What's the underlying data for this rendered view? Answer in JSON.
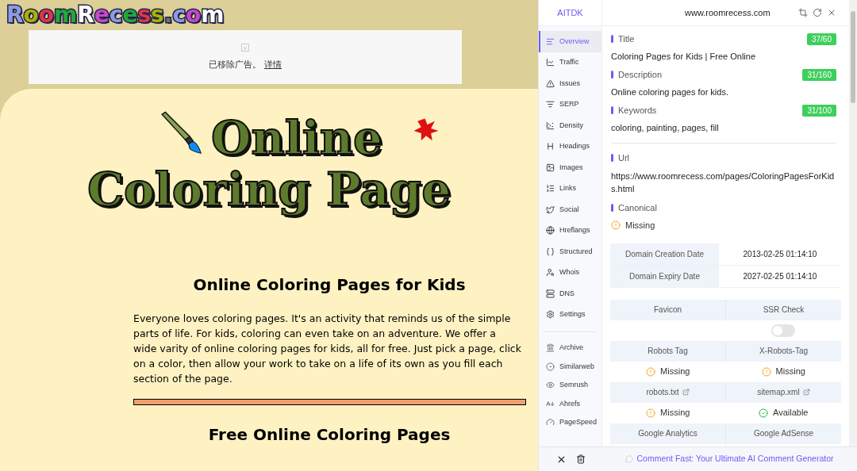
{
  "site": {
    "logo_letters": [
      {
        "char": "R",
        "color": "#8c9ce0"
      },
      {
        "char": "o",
        "color": "#a8b400"
      },
      {
        "char": "o",
        "color": "#e2334a"
      },
      {
        "char": "m",
        "color": "#22a83a"
      },
      {
        "char": "R",
        "color": "#ffffff"
      },
      {
        "char": "e",
        "color": "#c848c8"
      },
      {
        "char": "c",
        "color": "#8c9ce0"
      },
      {
        "char": "e",
        "color": "#22a83a"
      },
      {
        "char": "s",
        "color": "#e2334a"
      },
      {
        "char": "s",
        "color": "#a8b400"
      },
      {
        "char": ".",
        "color": "#707070"
      },
      {
        "char": "c",
        "color": "#8c9ce0"
      },
      {
        "char": "o",
        "color": "#c848c8"
      },
      {
        "char": "m",
        "color": "#ffffff"
      }
    ],
    "ad_notice": {
      "text": "已移除广告。",
      "link": "详情"
    },
    "banner": {
      "line_1": "Online",
      "line_2": "Coloring Page"
    },
    "heading": "Online Coloring Pages for Kids",
    "intro": "Everyone loves coloring pages. It's an activity that reminds us of the simple parts of life. For kids, coloring can even take on an adventure. We offer a wide varity of online coloring pages for kids, all for free. Just pick a page, click on a color, then allow your work to take on a life of its own as you fill each section of the page.",
    "subheading": "Free Online Coloring Pages"
  },
  "extension": {
    "brand": "AITDK",
    "domain": "www.roomrecess.com",
    "nav": [
      {
        "label": "Overview",
        "selected": true
      },
      {
        "label": "Traffic",
        "selected": false
      },
      {
        "label": "Issues",
        "selected": false
      },
      {
        "label": "SERP",
        "selected": false
      },
      {
        "label": "Density",
        "selected": false
      },
      {
        "label": "Headings",
        "selected": false
      },
      {
        "label": "Images",
        "selected": false
      },
      {
        "label": "Links",
        "selected": false
      },
      {
        "label": "Social",
        "selected": false
      },
      {
        "label": "Hreflangs",
        "selected": false
      },
      {
        "label": "Structured",
        "selected": false
      },
      {
        "label": "Whois",
        "selected": false
      },
      {
        "label": "DNS",
        "selected": false
      },
      {
        "label": "Settings",
        "selected": false
      }
    ],
    "tools": [
      "Archive",
      "Similarweb",
      "Semrush",
      "Ahrefs",
      "PageSpeed"
    ],
    "meta": [
      {
        "label": "Title",
        "count": "37/60",
        "value": "Coloring Pages for Kids | Free Online"
      },
      {
        "label": "Description",
        "count": "31/160",
        "value": "Online coloring pages for kids."
      },
      {
        "label": "Keywords",
        "count": "31/100",
        "value": "coloring, painting, pages, fill"
      }
    ],
    "url": {
      "label": "Url",
      "value": "https://www.roomrecess.com/pages/ColoringPagesForKids.html"
    },
    "canonical": {
      "label": "Canonical",
      "kind": "missing",
      "text": "Missing"
    },
    "domain_dates": [
      {
        "label": "Domain Creation Date",
        "value": "2013-02-25 01:14:10"
      },
      {
        "label": "Domain Expiry Date",
        "value": "2027-02-25 01:14:10"
      }
    ],
    "checks": [
      {
        "kind": "header",
        "cells": [
          {
            "text": "Favicon",
            "external": false
          },
          {
            "text": "SSR Check",
            "external": false
          }
        ]
      },
      {
        "kind": "values",
        "cells": [
          {
            "kind": "empty"
          },
          {
            "kind": "toggle",
            "on": false
          }
        ]
      },
      {
        "kind": "header",
        "cells": [
          {
            "text": "Robots Tag",
            "external": false
          },
          {
            "text": "X-Robots-Tag",
            "external": false
          }
        ]
      },
      {
        "kind": "values",
        "cells": [
          {
            "kind": "missing",
            "text": "Missing"
          },
          {
            "kind": "missing",
            "text": "Missing"
          }
        ]
      },
      {
        "kind": "header",
        "cells": [
          {
            "text": "robots.txt",
            "external": true
          },
          {
            "text": "sitemap.xml",
            "external": true
          }
        ]
      },
      {
        "kind": "values",
        "cells": [
          {
            "kind": "missing",
            "text": "Missing"
          },
          {
            "kind": "available",
            "text": "Available"
          }
        ]
      },
      {
        "kind": "header",
        "cells": [
          {
            "text": "Google Analytics",
            "external": false
          },
          {
            "text": "Google AdSense",
            "external": false
          }
        ]
      }
    ],
    "promo": "Comment Fast: Your Ultimate AI Comment Generator"
  }
}
